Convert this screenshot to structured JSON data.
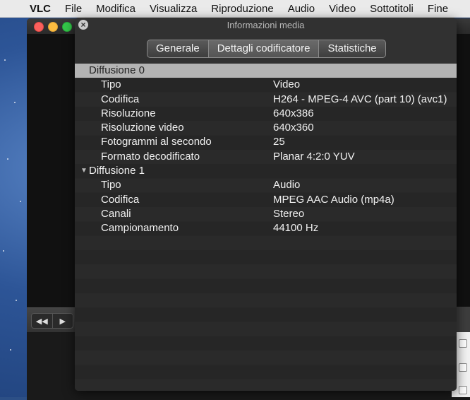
{
  "menubar": {
    "items": [
      "VLC",
      "File",
      "Modifica",
      "Visualizza",
      "Riproduzione",
      "Audio",
      "Video",
      "Sottotitoli",
      "Fine"
    ]
  },
  "panel": {
    "title": "Informazioni media",
    "tabs": [
      "Generale",
      "Dettagli codificatore",
      "Statistiche"
    ],
    "active_tab": "Dettagli codificatore"
  },
  "streams": [
    {
      "name": "Diffusione 0",
      "rows": [
        {
          "label": "Tipo",
          "value": "Video"
        },
        {
          "label": "Codifica",
          "value": "H264 - MPEG-4 AVC (part 10) (avc1)"
        },
        {
          "label": "Risoluzione",
          "value": "640x386"
        },
        {
          "label": "Risoluzione video",
          "value": "640x360"
        },
        {
          "label": "Fotogrammi al secondo",
          "value": "25"
        },
        {
          "label": "Formato decodificato",
          "value": "Planar 4:2:0 YUV"
        }
      ]
    },
    {
      "name": "Diffusione 1",
      "rows": [
        {
          "label": "Tipo",
          "value": "Audio"
        },
        {
          "label": "Codifica",
          "value": "MPEG AAC Audio (mp4a)"
        },
        {
          "label": "Canali",
          "value": "Stereo"
        },
        {
          "label": "Campionamento",
          "value": "44100 Hz"
        }
      ]
    }
  ],
  "colors": {
    "panel_bg": "#313131",
    "selected_row": "#b3b3b3",
    "desktop": "#2d5597"
  }
}
